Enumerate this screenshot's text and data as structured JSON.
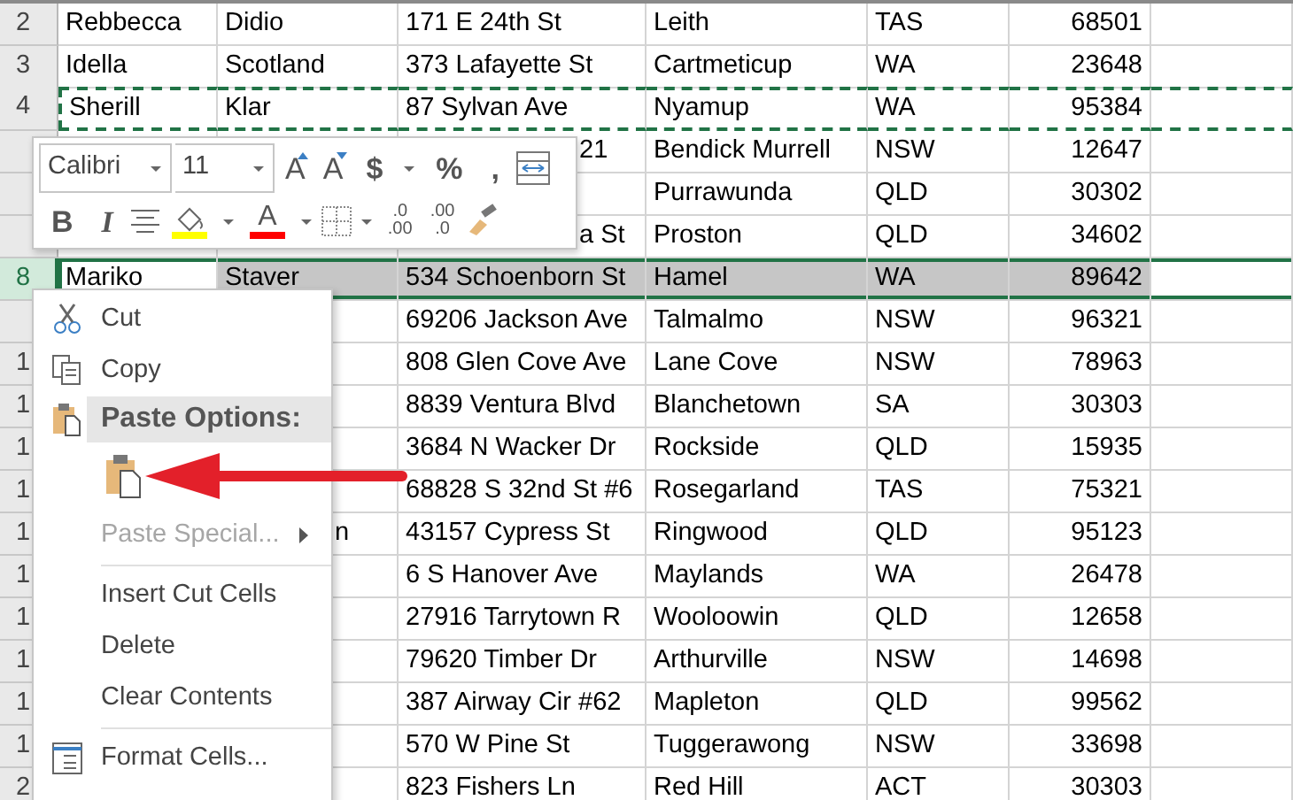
{
  "rows": [
    {
      "header": "2",
      "selected": false,
      "copied": false,
      "column_1": "Rebbecca",
      "column_2": "Didio",
      "column_3": "171 E 24th St",
      "column_4": "Leith",
      "column_5": "TAS",
      "column_6": "68501"
    },
    {
      "header": "3",
      "selected": false,
      "copied": false,
      "column_1": "Idella",
      "column_2": "Scotland",
      "column_3": "373 Lafayette St",
      "column_4": "Cartmeticup",
      "column_5": "WA",
      "column_6": "23648"
    },
    {
      "header": "4",
      "selected": false,
      "copied": true,
      "column_1": "Sherill",
      "column_2": "Klar",
      "column_3": "87 Sylvan Ave",
      "column_4": "Nyamup",
      "column_5": "WA",
      "column_6": "95384"
    },
    {
      "selected": false,
      "copied": false,
      "column_3": {
        "text": "21",
        "kind": "fragment"
      },
      "column_4": "Bendick Murrell",
      "column_5": "NSW",
      "column_6": "12647"
    },
    {
      "selected": false,
      "copied": false,
      "column_4": "Purrawunda",
      "column_5": "QLD",
      "column_6": "30302"
    },
    {
      "selected": false,
      "copied": false,
      "column_3": {
        "text": "a St",
        "kind": "fragment"
      },
      "column_4": "Proston",
      "column_5": "QLD",
      "column_6": "34602"
    },
    {
      "header": "8",
      "selected": true,
      "copied": false,
      "column_1": "Mariko",
      "column_2": "Staver",
      "column_3": "534 Schoenborn St",
      "column_4": "Hamel",
      "column_5": "WA",
      "column_6": "89642"
    },
    {
      "selected": false,
      "copied": false,
      "column_3": "69206 Jackson Ave",
      "column_4": "Talmalmo",
      "column_5": "NSW",
      "column_6": "96321"
    },
    {
      "header": "1",
      "selected": false,
      "copied": false,
      "column_3": "808 Glen Cove Ave",
      "column_4": "Lane Cove",
      "column_5": "NSW",
      "column_6": "78963"
    },
    {
      "header": "1",
      "selected": false,
      "copied": false,
      "column_3": "8839 Ventura Blvd",
      "column_4": "Blanchetown",
      "column_5": "SA",
      "column_6": "30303"
    },
    {
      "header": "1",
      "selected": false,
      "copied": false,
      "column_3": "3684 N Wacker Dr",
      "column_4": "Rockside",
      "column_5": "QLD",
      "column_6": "15935"
    },
    {
      "header": "1",
      "selected": false,
      "copied": false,
      "column_3": "68828 S 32nd St #6",
      "column_4": "Rosegarland",
      "column_5": "TAS",
      "column_6": "75321"
    },
    {
      "header": "1",
      "selected": false,
      "copied": false,
      "column_2": {
        "text": "n",
        "kind": "fragment"
      },
      "column_3": "43157 Cypress St",
      "column_4": "Ringwood",
      "column_5": "QLD",
      "column_6": "95123"
    },
    {
      "header": "1",
      "selected": false,
      "copied": false,
      "column_3": "6 S Hanover Ave",
      "column_4": "Maylands",
      "column_5": "WA",
      "column_6": "26478"
    },
    {
      "header": "1",
      "selected": false,
      "copied": false,
      "column_3": "27916 Tarrytown R",
      "column_4": "Wooloowin",
      "column_5": "QLD",
      "column_6": "12658"
    },
    {
      "header": "1",
      "selected": false,
      "copied": false,
      "column_3": "79620 Timber Dr",
      "column_4": "Arthurville",
      "column_5": "NSW",
      "column_6": "14698"
    },
    {
      "header": "1",
      "selected": false,
      "copied": false,
      "column_3": "387 Airway Cir #62",
      "column_4": "Mapleton",
      "column_5": "QLD",
      "column_6": "99562"
    },
    {
      "header": "1",
      "selected": false,
      "copied": false,
      "column_3": "570 W Pine St",
      "column_4": "Tuggerawong",
      "column_5": "NSW",
      "column_6": "33698"
    },
    {
      "header": "2",
      "selected": false,
      "copied": false,
      "column_3": "823 Fishers Ln",
      "column_4": "Red Hill",
      "column_5": "ACT",
      "column_6": "30303"
    }
  ],
  "mini_toolbar": {
    "font": "Calibri",
    "size": "11",
    "row_1": [
      {
        "kind": "grow",
        "text": "A"
      },
      {
        "kind": "shrink",
        "text": "A"
      },
      {
        "kind": "char",
        "text": "$"
      },
      {
        "kind": "caret"
      },
      {
        "kind": "char",
        "text": "%"
      },
      {
        "kind": "char",
        "text": ","
      },
      {
        "kind": "wrap"
      }
    ],
    "row_2": [
      {
        "kind": "bold",
        "text": "B"
      },
      {
        "kind": "italic",
        "text": "I"
      },
      {
        "kind": "align"
      },
      {
        "kind": "fill",
        "color": "#ffff00"
      },
      {
        "kind": "caret"
      },
      {
        "kind": "font_color",
        "text": "A",
        "color": "#ff0000"
      },
      {
        "kind": "caret"
      },
      {
        "kind": "borders"
      },
      {
        "kind": "caret"
      },
      {
        "kind": "increase_decimal",
        "top": ".0",
        "bottom": ".00"
      },
      {
        "kind": "decrease_decimal",
        "top": ".00",
        "bottom": ".0"
      },
      {
        "kind": "painter"
      }
    ]
  },
  "context_menu": [
    {
      "kind": "cut",
      "label": "Cut",
      "disabled": false,
      "submenu": false
    },
    {
      "kind": "copy",
      "label": "Copy",
      "disabled": false,
      "submenu": false
    },
    {
      "kind": "paste_header",
      "label": "Paste Options:"
    },
    {
      "kind": "paste_option"
    },
    {
      "kind": "plain",
      "label": "Paste Special...",
      "disabled": true,
      "submenu": true
    },
    {
      "kind": "separator"
    },
    {
      "kind": "plain",
      "label": "Insert Cut Cells",
      "disabled": false,
      "submenu": false
    },
    {
      "kind": "plain",
      "label": "Delete",
      "disabled": false,
      "submenu": false
    },
    {
      "kind": "plain",
      "label": "Clear Contents",
      "disabled": false,
      "submenu": false
    },
    {
      "kind": "separator"
    },
    {
      "kind": "format",
      "label": "Format Cells...",
      "disabled": false,
      "submenu": false
    }
  ]
}
